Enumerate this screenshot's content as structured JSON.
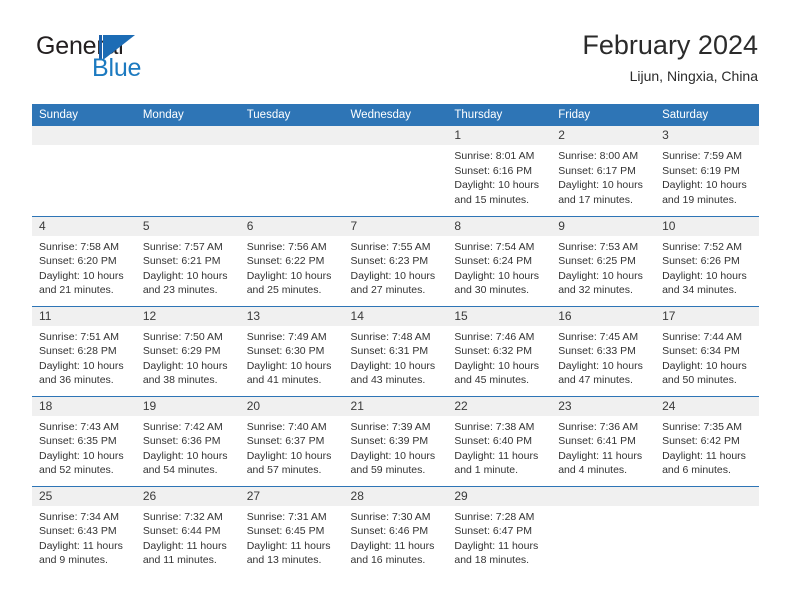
{
  "brand": {
    "name_part1": "General",
    "name_part2": "Blue",
    "mark": "blue-triangle-logo"
  },
  "header": {
    "title": "February 2024",
    "subtitle": "Lijun, Ningxia, China"
  },
  "calendar": {
    "weekday_headers": [
      "Sunday",
      "Monday",
      "Tuesday",
      "Wednesday",
      "Thursday",
      "Friday",
      "Saturday"
    ],
    "colors": {
      "header_blue": "#2e75b6",
      "daynum_band": "#f0f0f0",
      "text": "#333333",
      "brand_blue": "#1c7ac0"
    },
    "weeks": [
      [
        {
          "day": "",
          "empty": true
        },
        {
          "day": "",
          "empty": true
        },
        {
          "day": "",
          "empty": true
        },
        {
          "day": "",
          "empty": true
        },
        {
          "day": "1",
          "sunrise": "Sunrise: 8:01 AM",
          "sunset": "Sunset: 6:16 PM",
          "daylight_line1": "Daylight: 10 hours",
          "daylight_line2": "and 15 minutes."
        },
        {
          "day": "2",
          "sunrise": "Sunrise: 8:00 AM",
          "sunset": "Sunset: 6:17 PM",
          "daylight_line1": "Daylight: 10 hours",
          "daylight_line2": "and 17 minutes."
        },
        {
          "day": "3",
          "sunrise": "Sunrise: 7:59 AM",
          "sunset": "Sunset: 6:19 PM",
          "daylight_line1": "Daylight: 10 hours",
          "daylight_line2": "and 19 minutes."
        }
      ],
      [
        {
          "day": "4",
          "sunrise": "Sunrise: 7:58 AM",
          "sunset": "Sunset: 6:20 PM",
          "daylight_line1": "Daylight: 10 hours",
          "daylight_line2": "and 21 minutes."
        },
        {
          "day": "5",
          "sunrise": "Sunrise: 7:57 AM",
          "sunset": "Sunset: 6:21 PM",
          "daylight_line1": "Daylight: 10 hours",
          "daylight_line2": "and 23 minutes."
        },
        {
          "day": "6",
          "sunrise": "Sunrise: 7:56 AM",
          "sunset": "Sunset: 6:22 PM",
          "daylight_line1": "Daylight: 10 hours",
          "daylight_line2": "and 25 minutes."
        },
        {
          "day": "7",
          "sunrise": "Sunrise: 7:55 AM",
          "sunset": "Sunset: 6:23 PM",
          "daylight_line1": "Daylight: 10 hours",
          "daylight_line2": "and 27 minutes."
        },
        {
          "day": "8",
          "sunrise": "Sunrise: 7:54 AM",
          "sunset": "Sunset: 6:24 PM",
          "daylight_line1": "Daylight: 10 hours",
          "daylight_line2": "and 30 minutes."
        },
        {
          "day": "9",
          "sunrise": "Sunrise: 7:53 AM",
          "sunset": "Sunset: 6:25 PM",
          "daylight_line1": "Daylight: 10 hours",
          "daylight_line2": "and 32 minutes."
        },
        {
          "day": "10",
          "sunrise": "Sunrise: 7:52 AM",
          "sunset": "Sunset: 6:26 PM",
          "daylight_line1": "Daylight: 10 hours",
          "daylight_line2": "and 34 minutes."
        }
      ],
      [
        {
          "day": "11",
          "sunrise": "Sunrise: 7:51 AM",
          "sunset": "Sunset: 6:28 PM",
          "daylight_line1": "Daylight: 10 hours",
          "daylight_line2": "and 36 minutes."
        },
        {
          "day": "12",
          "sunrise": "Sunrise: 7:50 AM",
          "sunset": "Sunset: 6:29 PM",
          "daylight_line1": "Daylight: 10 hours",
          "daylight_line2": "and 38 minutes."
        },
        {
          "day": "13",
          "sunrise": "Sunrise: 7:49 AM",
          "sunset": "Sunset: 6:30 PM",
          "daylight_line1": "Daylight: 10 hours",
          "daylight_line2": "and 41 minutes."
        },
        {
          "day": "14",
          "sunrise": "Sunrise: 7:48 AM",
          "sunset": "Sunset: 6:31 PM",
          "daylight_line1": "Daylight: 10 hours",
          "daylight_line2": "and 43 minutes."
        },
        {
          "day": "15",
          "sunrise": "Sunrise: 7:46 AM",
          "sunset": "Sunset: 6:32 PM",
          "daylight_line1": "Daylight: 10 hours",
          "daylight_line2": "and 45 minutes."
        },
        {
          "day": "16",
          "sunrise": "Sunrise: 7:45 AM",
          "sunset": "Sunset: 6:33 PM",
          "daylight_line1": "Daylight: 10 hours",
          "daylight_line2": "and 47 minutes."
        },
        {
          "day": "17",
          "sunrise": "Sunrise: 7:44 AM",
          "sunset": "Sunset: 6:34 PM",
          "daylight_line1": "Daylight: 10 hours",
          "daylight_line2": "and 50 minutes."
        }
      ],
      [
        {
          "day": "18",
          "sunrise": "Sunrise: 7:43 AM",
          "sunset": "Sunset: 6:35 PM",
          "daylight_line1": "Daylight: 10 hours",
          "daylight_line2": "and 52 minutes."
        },
        {
          "day": "19",
          "sunrise": "Sunrise: 7:42 AM",
          "sunset": "Sunset: 6:36 PM",
          "daylight_line1": "Daylight: 10 hours",
          "daylight_line2": "and 54 minutes."
        },
        {
          "day": "20",
          "sunrise": "Sunrise: 7:40 AM",
          "sunset": "Sunset: 6:37 PM",
          "daylight_line1": "Daylight: 10 hours",
          "daylight_line2": "and 57 minutes."
        },
        {
          "day": "21",
          "sunrise": "Sunrise: 7:39 AM",
          "sunset": "Sunset: 6:39 PM",
          "daylight_line1": "Daylight: 10 hours",
          "daylight_line2": "and 59 minutes."
        },
        {
          "day": "22",
          "sunrise": "Sunrise: 7:38 AM",
          "sunset": "Sunset: 6:40 PM",
          "daylight_line1": "Daylight: 11 hours",
          "daylight_line2": "and 1 minute."
        },
        {
          "day": "23",
          "sunrise": "Sunrise: 7:36 AM",
          "sunset": "Sunset: 6:41 PM",
          "daylight_line1": "Daylight: 11 hours",
          "daylight_line2": "and 4 minutes."
        },
        {
          "day": "24",
          "sunrise": "Sunrise: 7:35 AM",
          "sunset": "Sunset: 6:42 PM",
          "daylight_line1": "Daylight: 11 hours",
          "daylight_line2": "and 6 minutes."
        }
      ],
      [
        {
          "day": "25",
          "sunrise": "Sunrise: 7:34 AM",
          "sunset": "Sunset: 6:43 PM",
          "daylight_line1": "Daylight: 11 hours",
          "daylight_line2": "and 9 minutes."
        },
        {
          "day": "26",
          "sunrise": "Sunrise: 7:32 AM",
          "sunset": "Sunset: 6:44 PM",
          "daylight_line1": "Daylight: 11 hours",
          "daylight_line2": "and 11 minutes."
        },
        {
          "day": "27",
          "sunrise": "Sunrise: 7:31 AM",
          "sunset": "Sunset: 6:45 PM",
          "daylight_line1": "Daylight: 11 hours",
          "daylight_line2": "and 13 minutes."
        },
        {
          "day": "28",
          "sunrise": "Sunrise: 7:30 AM",
          "sunset": "Sunset: 6:46 PM",
          "daylight_line1": "Daylight: 11 hours",
          "daylight_line2": "and 16 minutes."
        },
        {
          "day": "29",
          "sunrise": "Sunrise: 7:28 AM",
          "sunset": "Sunset: 6:47 PM",
          "daylight_line1": "Daylight: 11 hours",
          "daylight_line2": "and 18 minutes."
        },
        {
          "day": "",
          "empty": true
        },
        {
          "day": "",
          "empty": true
        }
      ]
    ]
  }
}
